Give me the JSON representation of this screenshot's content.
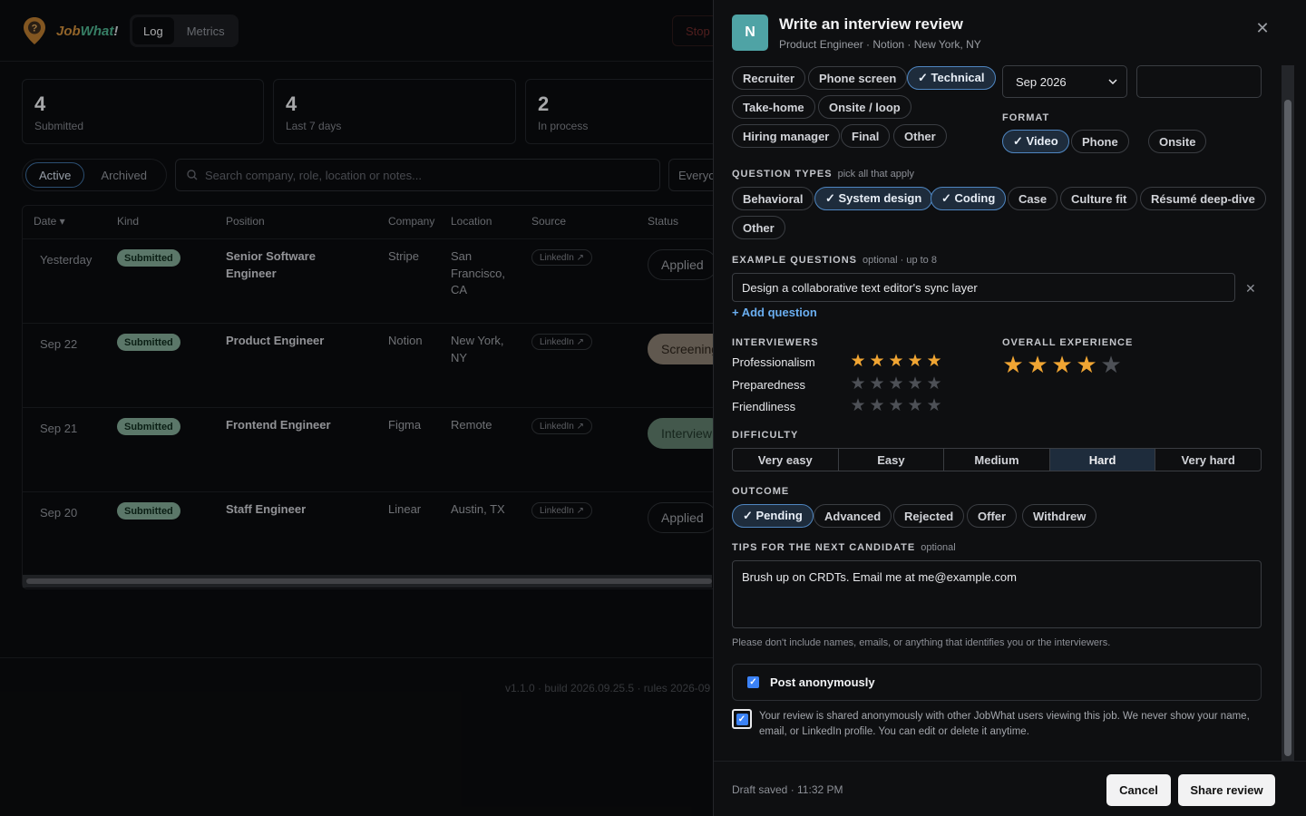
{
  "app": {
    "logo": {
      "part1": "Job",
      "part2": "What",
      "part3": "!"
    },
    "tabs": [
      "Log",
      "Metrics"
    ],
    "stop_label": "Stop",
    "stats": [
      {
        "value": "4",
        "label": "Submitted"
      },
      {
        "value": "4",
        "label": "Last 7 days"
      },
      {
        "value": "2",
        "label": "In process"
      }
    ],
    "filters": [
      "Active",
      "Archived"
    ],
    "search_placeholder": "Search company, role, location or notes...",
    "everyone_label": "Everyone",
    "columns": [
      "Date ▾",
      "Kind",
      "Position",
      "Company",
      "Location",
      "Source",
      "Status"
    ],
    "rows": [
      {
        "date": "Yesterday",
        "kind": "Submitted",
        "position": "Senior Software Engineer",
        "company": "Stripe",
        "location": "San Francisco, CA",
        "source": "LinkedIn ↗",
        "status": "Applied"
      },
      {
        "date": "Sep 22",
        "kind": "Submitted",
        "position": "Product Engineer",
        "company": "Notion",
        "location": "New York, NY",
        "source": "LinkedIn ↗",
        "status": "Screening"
      },
      {
        "date": "Sep 21",
        "kind": "Submitted",
        "position": "Frontend Engineer",
        "company": "Figma",
        "location": "Remote",
        "source": "LinkedIn ↗",
        "status": "Interview"
      },
      {
        "date": "Sep 20",
        "kind": "Submitted",
        "position": "Staff Engineer",
        "company": "Linear",
        "location": "Austin, TX",
        "source": "LinkedIn ↗",
        "status": "Applied"
      }
    ],
    "version": "v1.1.0 · build 2026.09.25.5 · rules 2026-09"
  },
  "drawer": {
    "avatar": "N",
    "title": "Write an interview review",
    "subtitle": "Product Engineer · Notion · New York, NY",
    "stage_chips": [
      "Recruiter",
      "Phone screen",
      "✓ Technical",
      "Take-home",
      "Onsite / loop",
      "Hiring manager",
      "Final",
      "Other"
    ],
    "date_select": "Sep 2026",
    "format_label": "FORMAT",
    "format_chips": [
      "✓ Video",
      "Phone",
      "Onsite"
    ],
    "qtypes_label": "QUESTION TYPES",
    "qtypes_hint": "pick all that apply",
    "qtypes_chips": [
      "Behavioral",
      "✓ System design",
      "✓ Coding",
      "Case",
      "Culture fit",
      "Résumé deep-dive",
      "Other"
    ],
    "examples_label": "EXAMPLE QUESTIONS",
    "examples_hint": "optional · up to 8",
    "example_question": "Design a collaborative text editor's sync layer",
    "add_question": "+ Add question",
    "interviewers_label": "INTERVIEWERS",
    "ratings": [
      {
        "label": "Professionalism",
        "value": 5
      },
      {
        "label": "Preparedness",
        "value": 0
      },
      {
        "label": "Friendliness",
        "value": 0
      }
    ],
    "overall_label": "OVERALL EXPERIENCE",
    "overall_value": 4,
    "difficulty_label": "DIFFICULTY",
    "difficulty": [
      "Very easy",
      "Easy",
      "Medium",
      "Hard",
      "Very hard"
    ],
    "difficulty_selected": "Hard",
    "outcome_label": "OUTCOME",
    "outcome_chips": [
      "✓ Pending",
      "Advanced",
      "Rejected",
      "Offer",
      "Withdrew"
    ],
    "tips_label": "TIPS FOR THE NEXT CANDIDATE",
    "tips_hint": "optional",
    "tips_value": "Brush up on CRDTs. Email me at me@example.com",
    "privacy_note": "Please don't include names, emails, or anything that identifies you or the interviewers.",
    "anon_label": "Post anonymously",
    "consent_text": "Your review is shared anonymously with other JobWhat users viewing this job. We never show your name, email, or LinkedIn profile. You can edit or delete it anytime.",
    "draft_status": "Draft saved · 11:32 PM",
    "cancel_label": "Cancel",
    "share_label": "Share review"
  },
  "colors": {
    "accent": "#4f86c1",
    "star": "#f0a533",
    "avatar": "#4fa3a5"
  }
}
